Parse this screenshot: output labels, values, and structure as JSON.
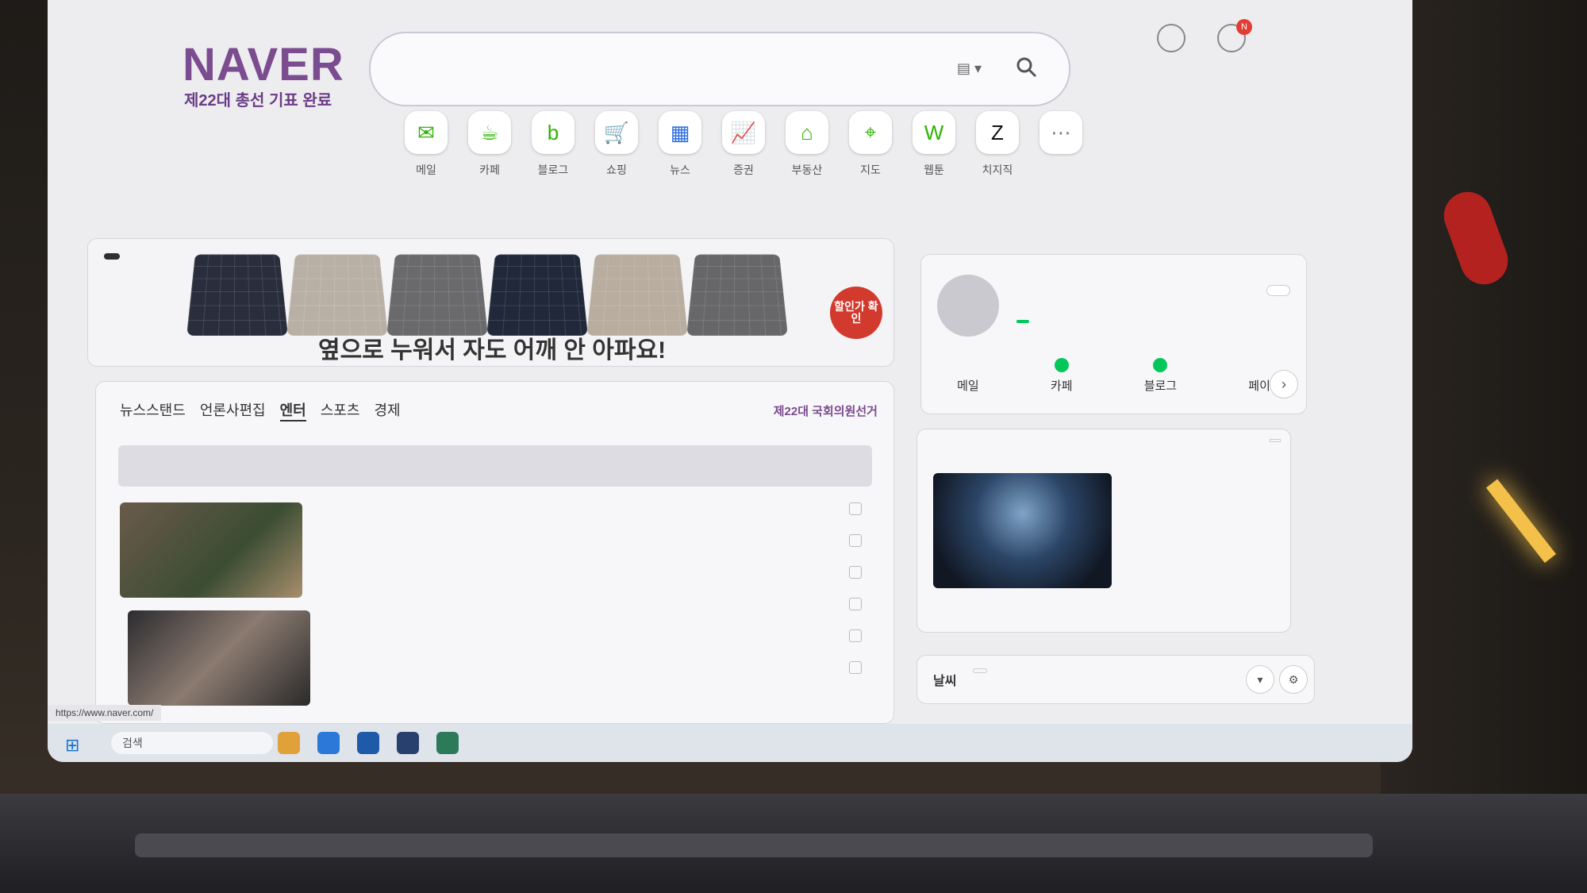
{
  "header": {
    "logo": "NAVER",
    "logo_sub": "제22대 총선 기표 완료",
    "search": {
      "placeholder": "",
      "kbd": "▤ ▾"
    }
  },
  "top_icons": {
    "bell_count": "N"
  },
  "shortcuts": [
    {
      "icon": "mail-icon",
      "glyph": "✉",
      "color": "#2db400",
      "label": "메일"
    },
    {
      "icon": "cafe-icon",
      "glyph": "☕",
      "color": "#2db400",
      "label": "카페"
    },
    {
      "icon": "blog-icon",
      "glyph": "b",
      "color": "#2db400",
      "label": "블로그"
    },
    {
      "icon": "shopping-icon",
      "glyph": "🛒",
      "color": "#1fa0e8",
      "label": "쇼핑"
    },
    {
      "icon": "news-icon",
      "glyph": "▦",
      "color": "#2a6be0",
      "label": "뉴스"
    },
    {
      "icon": "stock-icon",
      "glyph": "📈",
      "color": "#2db400",
      "label": "증권"
    },
    {
      "icon": "realestate-icon",
      "glyph": "⌂",
      "color": "#2db400",
      "label": "부동산"
    },
    {
      "icon": "map-icon",
      "glyph": "⌖",
      "color": "#2db400",
      "label": "지도"
    },
    {
      "icon": "webtoon-icon",
      "glyph": "W",
      "color": "#2db400",
      "label": "웹툰"
    },
    {
      "icon": "chzzk-icon",
      "glyph": "Z",
      "color": "#111111",
      "label": "치지직"
    },
    {
      "icon": "more-icon",
      "glyph": "⋯",
      "color": "#888888",
      "label": ""
    }
  ],
  "banner": {
    "ad_tag": "",
    "mat_colors": [
      "#2a2d3c",
      "#b9b0a5",
      "#6a6a6c",
      "#20283a",
      "#b8ad9f",
      "#67676a"
    ],
    "text": "옆으로 누워서 자도 어깨 안 아파요!",
    "badge": "할인가 확인"
  },
  "news": {
    "tabs": [
      "뉴스스탠드",
      "언론사편집",
      "엔터",
      "스포츠",
      "경제"
    ],
    "active_tab": "엔터",
    "promo": "제22대 국회의원선거",
    "subbar_left": "",
    "subbar_right": "",
    "captions": [
      "",
      ""
    ],
    "headlines": [
      {
        "text": "",
        "source": ""
      },
      {
        "text": "",
        "source": ""
      },
      {
        "text": "",
        "source": ""
      },
      {
        "text": "",
        "source": ""
      },
      {
        "text": "",
        "source": ""
      },
      {
        "text": "",
        "source": ""
      }
    ]
  },
  "profile": {
    "name": "",
    "email": "",
    "badge": "",
    "logout": "",
    "tabs": [
      {
        "label": "메일",
        "dot": false
      },
      {
        "label": "카페",
        "dot": true
      },
      {
        "label": "블로그",
        "dot": true
      },
      {
        "label": "페이",
        "dot": false
      }
    ],
    "next": "›"
  },
  "promo_card": {
    "title": "",
    "ad": "",
    "desc": "",
    "foot": "",
    "link": ""
  },
  "weather": {
    "label": "날씨",
    "tag": "",
    "right": "",
    "buttons": [
      "▾",
      "⚙"
    ]
  },
  "browser": {
    "status_url": "https://www.naver.com/"
  },
  "taskbar": {
    "search": "검색",
    "tray": "",
    "apps": [
      "#e0a03a",
      "#2b78d8",
      "#1e5aa8",
      "#27406e",
      "#2c7a5a"
    ]
  }
}
